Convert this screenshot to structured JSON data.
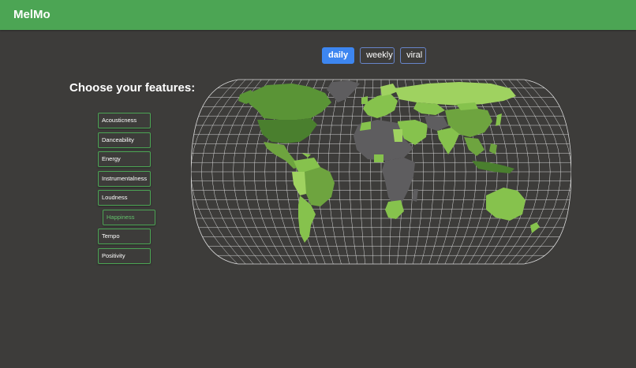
{
  "app": {
    "title": "MelMo"
  },
  "period_tabs": [
    {
      "label": "daily",
      "active": true
    },
    {
      "label": "weekly",
      "active": false
    },
    {
      "label": "viral",
      "active": false
    }
  ],
  "features": {
    "title": "Choose your features:",
    "items": [
      {
        "label": "Acousticness",
        "selected": false
      },
      {
        "label": "Danceability",
        "selected": false
      },
      {
        "label": "Energy",
        "selected": false
      },
      {
        "label": "Instrumentalness",
        "selected": false
      },
      {
        "label": "Loudness",
        "selected": false
      },
      {
        "label": "Happiness",
        "selected": true
      },
      {
        "label": "Tempo",
        "selected": false
      },
      {
        "label": "Positivity",
        "selected": false
      }
    ]
  },
  "colors": {
    "header": "#4ca554",
    "background": "#3d3c3a",
    "active_tab": "#3d86f0",
    "no_data_country": "#5e5d5f",
    "graticule": "#d9d9d9",
    "scale": [
      "#4a7f2e",
      "#5a9436",
      "#6ea43f",
      "#86c24d",
      "#9fd260"
    ]
  }
}
